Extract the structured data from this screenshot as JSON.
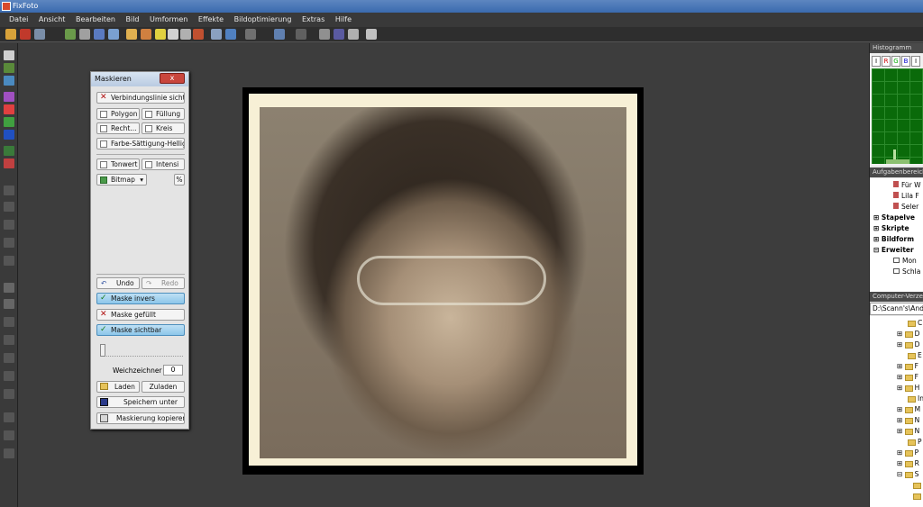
{
  "app": {
    "title": "FixFoto"
  },
  "menu": [
    "Datei",
    "Ansicht",
    "Bearbeiten",
    "Bild",
    "Umformen",
    "Effekte",
    "Bildoptimierung",
    "Extras",
    "Hilfe"
  ],
  "dialog": {
    "title": "Maskieren",
    "close": "x",
    "buttons": {
      "verbindungslinie": "Verbindungslinie sichtbar",
      "polygon": "Polygon",
      "fuellung": "Füllung",
      "recht": "Recht...",
      "kreis": "Kreis",
      "farbe": "Farbe-Sättigung-Hellig...",
      "tonwert": "Tonwert",
      "intensi": "Intensi",
      "bitmap": "Bitmap",
      "undo": "Undo",
      "redo": "Redo",
      "maske_invers": "Maske invers",
      "maske_gefuellt": "Maske gefüllt",
      "maske_sichtbar": "Maske sichtbar",
      "weichzeichner": "Weichzeichner",
      "weichzeichner_value": "0",
      "laden": "Laden",
      "zuladen": "Zuladen",
      "speichern_unter": "Speichern unter",
      "maskierung_kopieren": "Maskierung kopieren"
    }
  },
  "right_panel": {
    "histogram_title": "Histogramm",
    "histogram_tabs": [
      "I",
      "R",
      "G",
      "B",
      "I"
    ],
    "tasks_title": "Aufgabenbereich",
    "tasks": [
      "Für W",
      "Lila F",
      "Seler",
      "Stapelve",
      "Skripte",
      "Bildform",
      "Erweiter",
      "Mon",
      "Schla"
    ],
    "explorer_title": "Computer-Verze",
    "path": "D:\\Scann's\\And",
    "folders": [
      "C",
      "D",
      "D",
      "E",
      "F",
      "F",
      "H",
      "In",
      "M",
      "N",
      "N",
      "P",
      "P",
      "R",
      "S"
    ]
  },
  "colors": {
    "accent_blue": "#8cc6ea",
    "workspace": "#3d3d3d",
    "photo_paper": "#f7f0d6"
  }
}
